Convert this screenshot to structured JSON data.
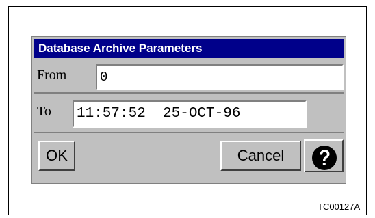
{
  "dialog": {
    "title": "Database Archive Parameters",
    "from": {
      "label": "From",
      "value": "0"
    },
    "to": {
      "label": "To",
      "value": "11:57:52  25-OCT-96"
    },
    "buttons": {
      "ok_label": "OK",
      "cancel_label": "Cancel",
      "help_icon": "question-mark-icon"
    }
  },
  "figure_id": "TC00127A",
  "colors": {
    "titlebar_bg": "#00008a",
    "titlebar_text": "#ffffff",
    "dialog_bg": "#c0c0c0",
    "field_bg": "#ffffff"
  }
}
